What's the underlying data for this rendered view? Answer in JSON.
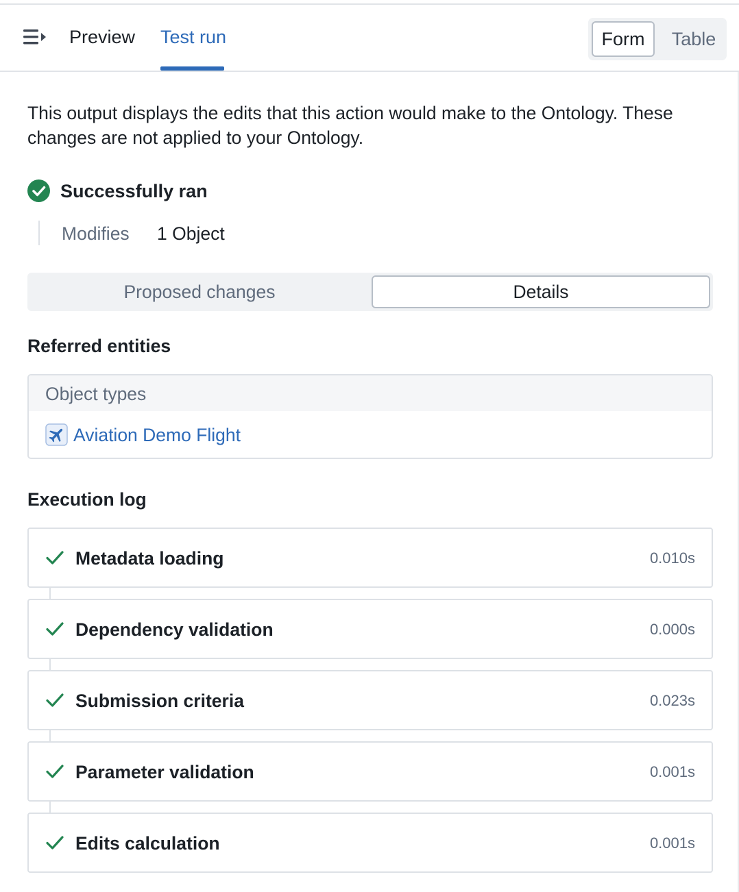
{
  "header": {
    "tabs": [
      {
        "label": "Preview",
        "active": false
      },
      {
        "label": "Test run",
        "active": true
      }
    ],
    "view_toggle": {
      "options": [
        "Form",
        "Table"
      ],
      "selected": "Form"
    },
    "icons": {
      "menu": "collapse-menu-icon"
    }
  },
  "description": "This output displays the edits that this action would make to the Ontology. These changes are not applied to your Ontology.",
  "status": {
    "icon": "success-check-circle-icon",
    "text": "Successfully ran",
    "modifies_label": "Modifies",
    "modifies_value": "1 Object"
  },
  "result_tabs": {
    "options": [
      "Proposed changes",
      "Details"
    ],
    "selected": "Details"
  },
  "referred_entities": {
    "title": "Referred entities",
    "header": "Object types",
    "items": [
      {
        "label": "Aviation Demo Flight",
        "icon": "airplane-icon"
      }
    ]
  },
  "execution_log": {
    "title": "Execution log",
    "items": [
      {
        "label": "Metadata loading",
        "time": "0.010s"
      },
      {
        "label": "Dependency validation",
        "time": "0.000s"
      },
      {
        "label": "Submission criteria",
        "time": "0.023s"
      },
      {
        "label": "Parameter validation",
        "time": "0.001s"
      },
      {
        "label": "Edits calculation",
        "time": "0.001s"
      }
    ]
  },
  "colors": {
    "accent": "#2d6ab8",
    "success": "#238551",
    "border": "#dde1e6",
    "muted_text": "#5f6b7c"
  }
}
